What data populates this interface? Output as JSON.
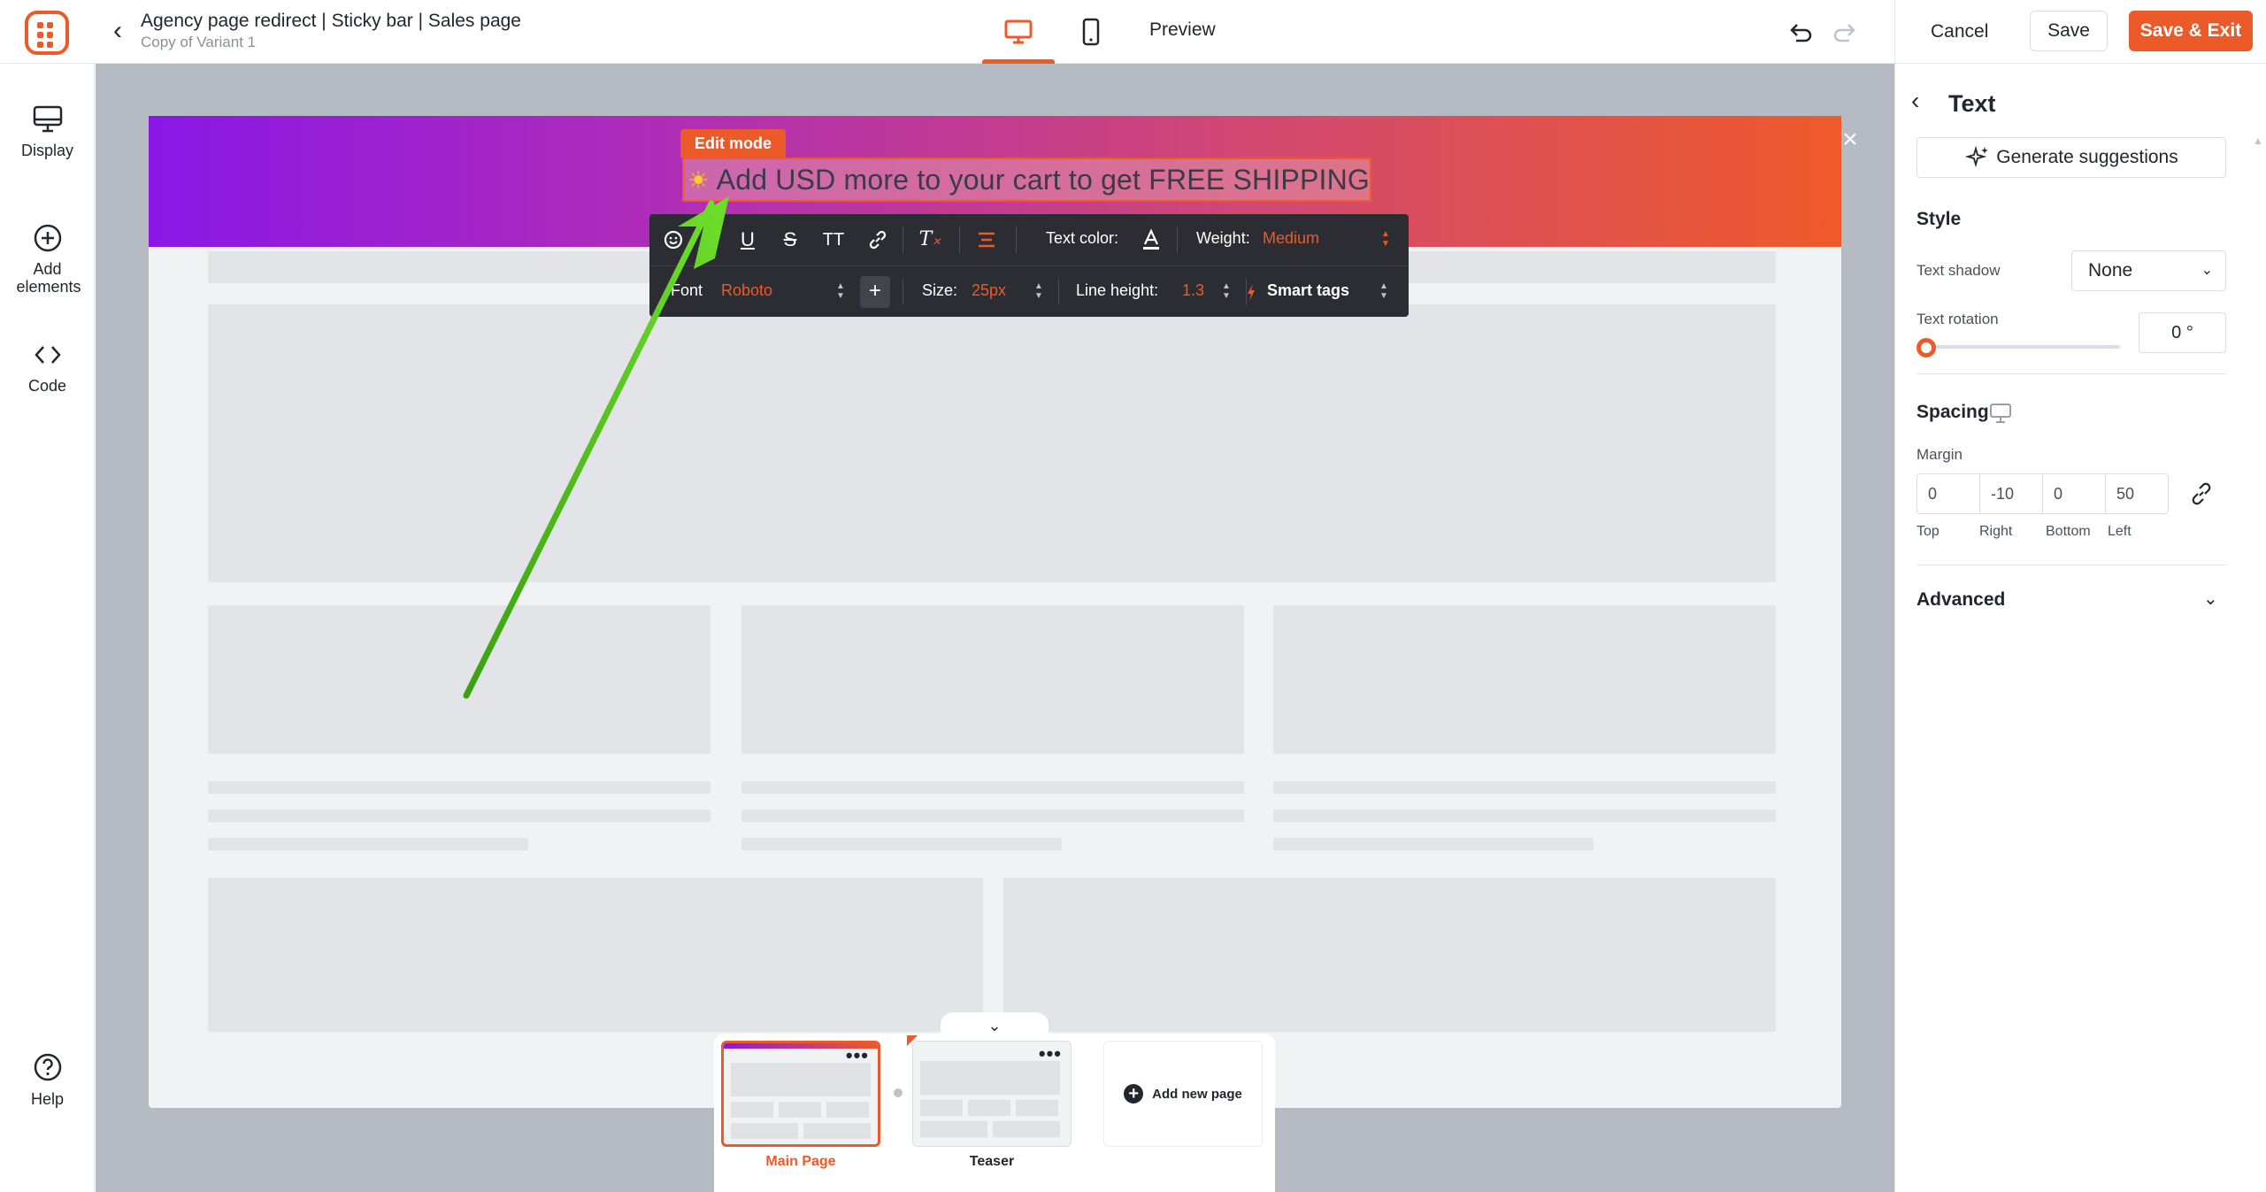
{
  "topbar": {
    "campaign_title": "Agency page redirect | Sticky bar | Sales page",
    "campaign_subtitle": "Copy of Variant 1",
    "preview_label": "Preview",
    "cancel_label": "Cancel",
    "save_label": "Save",
    "save_exit_label": "Save & Exit",
    "active_device": "desktop"
  },
  "sidebar": {
    "items": [
      {
        "label": "Display",
        "icon": "monitor-icon"
      },
      {
        "label": "Add elements",
        "icon": "plus-circle-icon"
      },
      {
        "label": "Code",
        "icon": "code-icon"
      }
    ],
    "help_label": "Help"
  },
  "canvas": {
    "edit_mode_label": "Edit mode",
    "headline": "Add USD more to your cart to get FREE SHIPPING",
    "close_symbol": "×"
  },
  "text_toolbar": {
    "text_color_label": "Text color:",
    "weight_label": "Weight:",
    "weight_value": "Medium",
    "font_label": "Font:",
    "font_value": "Roboto",
    "font_add_symbol": "+",
    "size_label": "Size:",
    "size_value": "25px",
    "line_height_label": "Line height:",
    "line_height_value": "1.3",
    "smart_tags_label": "Smart tags"
  },
  "pages": {
    "items": [
      {
        "label": "Main Page",
        "active": true
      },
      {
        "label": "Teaser",
        "active": false
      }
    ],
    "add_label": "Add new page",
    "menu_symbol": "•••"
  },
  "right_panel": {
    "title": "Text",
    "generate_label": "Generate suggestions",
    "style_heading": "Style",
    "text_shadow_label": "Text shadow",
    "text_shadow_value": "None",
    "text_rotation_label": "Text rotation",
    "text_rotation_value": "0 °",
    "rotation_fraction": 0,
    "spacing_heading": "Spacing",
    "margin_label": "Margin",
    "margin": [
      {
        "label": "Top",
        "value": "0"
      },
      {
        "label": "Right",
        "value": "-10"
      },
      {
        "label": "Bottom",
        "value": "0"
      },
      {
        "label": "Left",
        "value": "50"
      }
    ],
    "advanced_heading": "Advanced"
  },
  "colors": {
    "accent": "#ed5a29",
    "bar_gradient_start": "#8a17e6",
    "bar_gradient_end": "#ef5a2a",
    "annotation_arrow": "#5ccc1f"
  }
}
